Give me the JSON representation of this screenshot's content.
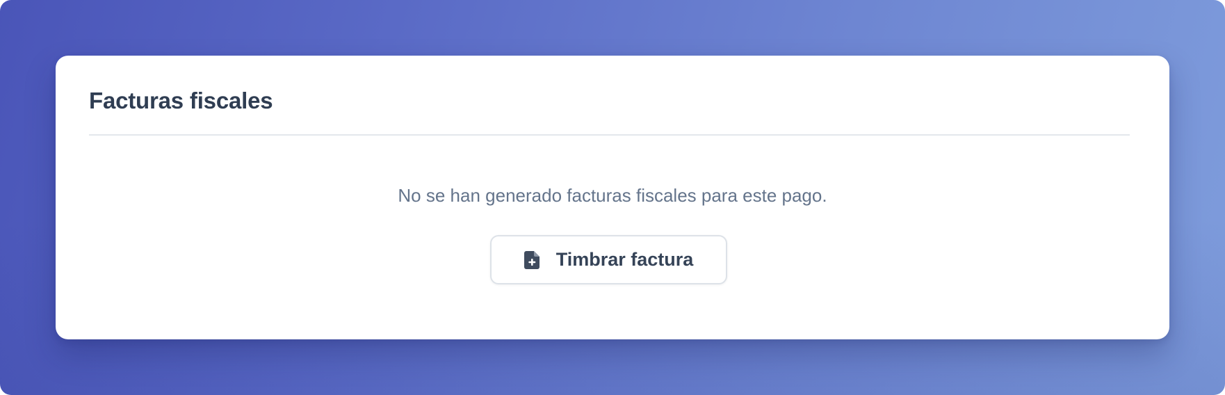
{
  "card": {
    "title": "Facturas fiscales",
    "empty_message": "No se han generado facturas fiscales para este pago."
  },
  "action": {
    "label": "Timbrar factura",
    "icon": "file-plus-icon"
  },
  "colors": {
    "gradient_start": "#4a55b8",
    "gradient_end": "#7f9ddc",
    "card_background": "#ffffff",
    "title_text": "#2f3d52",
    "message_text": "#64748b",
    "button_text": "#354357",
    "button_border": "#dde2e8"
  }
}
